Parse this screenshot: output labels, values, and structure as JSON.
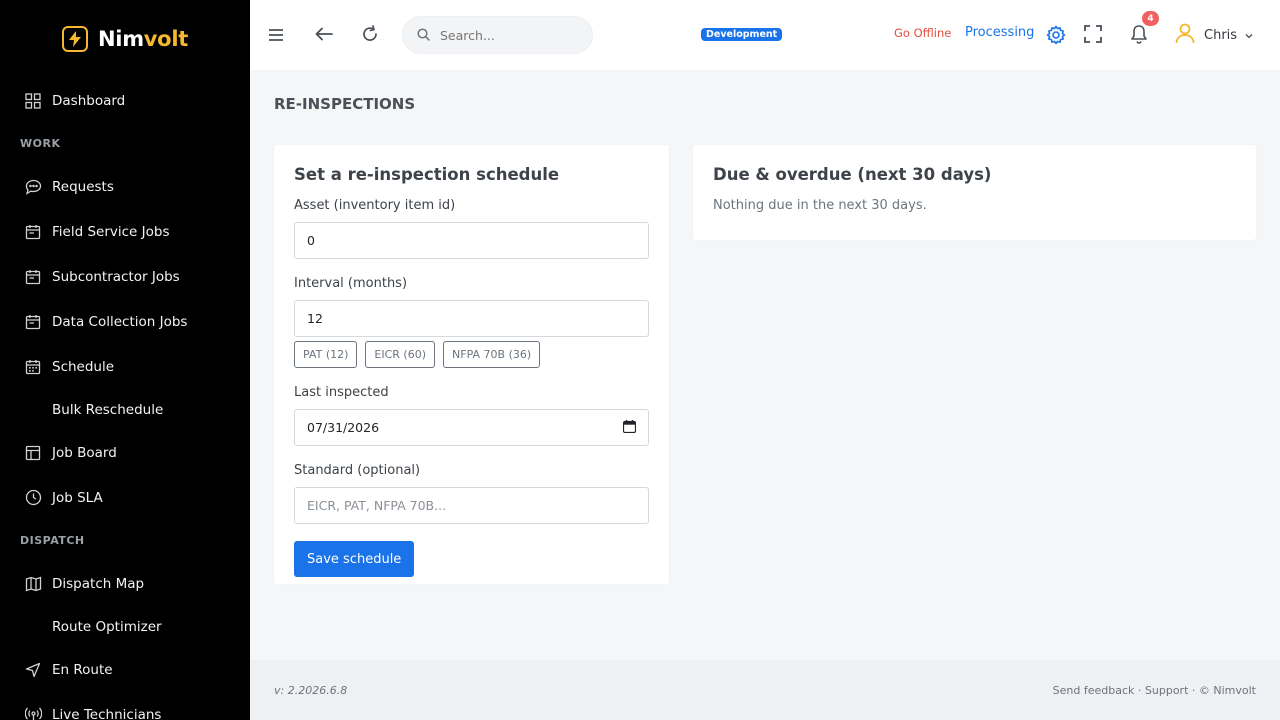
{
  "brand": {
    "name_main": "Nim",
    "name_accent": "volt"
  },
  "sidebar": {
    "dashboard": "Dashboard",
    "section_work": "WORK",
    "work_items": [
      {
        "label": "Requests",
        "icon": "chat-icon"
      },
      {
        "label": "Field Service Jobs",
        "icon": "calendar-icon"
      },
      {
        "label": "Subcontractor Jobs",
        "icon": "calendar-icon"
      },
      {
        "label": "Data Collection Jobs",
        "icon": "calendar-icon"
      },
      {
        "label": "Schedule",
        "icon": "calendar-grid-icon"
      }
    ],
    "bulk_reschedule": "Bulk Reschedule",
    "job_board": "Job Board",
    "job_sla": "Job SLA",
    "section_dispatch": "DISPATCH",
    "dispatch_map": "Dispatch Map",
    "route_optimizer": "Route Optimizer",
    "en_route": "En Route",
    "live_technicians": "Live Technicians"
  },
  "topbar": {
    "search_placeholder": "Search...",
    "environment_badge": "Development",
    "go_offline": "Go Offline",
    "processing": "Processing",
    "notification_count": "4",
    "user_name": "Chris"
  },
  "page": {
    "title": "RE-INSPECTIONS"
  },
  "schedule_form": {
    "heading": "Set a re-inspection schedule",
    "asset_label": "Asset (inventory item id)",
    "asset_value": "0",
    "interval_label": "Interval (months)",
    "interval_value": "12",
    "presets": [
      "PAT (12)",
      "EICR (60)",
      "NFPA 70B (36)"
    ],
    "last_inspected_label": "Last inspected",
    "last_inspected_value": "07/31/2026",
    "standard_label": "Standard (optional)",
    "standard_placeholder": "EICR, PAT, NFPA 70B...",
    "save_label": "Save schedule"
  },
  "due_panel": {
    "heading": "Due & overdue (next 30 days)",
    "empty_message": "Nothing due in the next 30 days."
  },
  "footer": {
    "version": "v: 2.2026.6.8",
    "send_feedback": "Send feedback",
    "sep1": " · ",
    "support": "Support",
    "sep2": " · ",
    "copyright": "© Nimvolt"
  },
  "colors": {
    "accent": "#1a73e8",
    "brand": "#f5b82e",
    "danger": "#e74c3c"
  }
}
